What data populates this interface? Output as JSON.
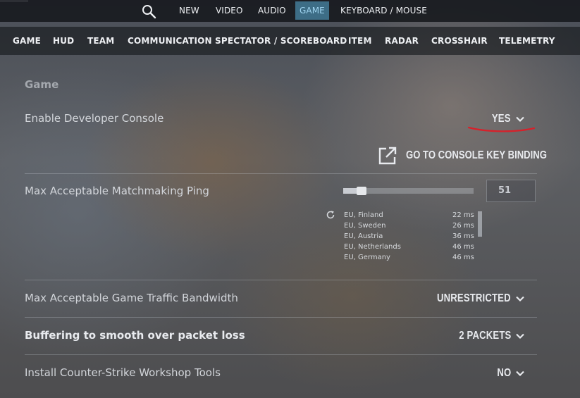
{
  "top_nav": {
    "search_icon": "search-icon",
    "items": [
      "NEW",
      "VIDEO",
      "AUDIO",
      "GAME",
      "KEYBOARD / MOUSE"
    ],
    "active": "GAME"
  },
  "sub_nav": {
    "items": [
      "GAME",
      "HUD",
      "TEAM",
      "COMMUNICATION",
      "SPECTATOR / SCOREBOARD",
      "ITEM",
      "RADAR",
      "CROSSHAIR",
      "TELEMETRY"
    ],
    "active": "GAME"
  },
  "section": {
    "title": "Game"
  },
  "settings": {
    "developer_console": {
      "label": "Enable Developer Console",
      "value": "YES"
    },
    "console_link": {
      "label": "GO TO CONSOLE KEY BINDING",
      "icon": "external-link-icon"
    },
    "max_ping": {
      "label": "Max Acceptable Matchmaking Ping",
      "value": "51",
      "slider_fraction": 0.11,
      "servers": [
        {
          "name": "EU, Finland",
          "ping": "22 ms"
        },
        {
          "name": "EU, Sweden",
          "ping": "26 ms"
        },
        {
          "name": "EU, Austria",
          "ping": "36 ms"
        },
        {
          "name": "EU, Netherlands",
          "ping": "46 ms"
        },
        {
          "name": "EU, Germany",
          "ping": "46 ms"
        }
      ]
    },
    "bandwidth": {
      "label": "Max Acceptable Game Traffic Bandwidth",
      "value": "UNRESTRICTED"
    },
    "buffering": {
      "label": "Buffering to smooth over packet loss",
      "value": "2 PACKETS"
    },
    "workshop_tools": {
      "label": "Install Counter-Strike Workshop Tools",
      "value": "NO"
    }
  },
  "colors": {
    "active_tab_bg": "#3d6d86",
    "active_tab_text": "#9fd4f0",
    "annotation_red": "#d8202a"
  }
}
